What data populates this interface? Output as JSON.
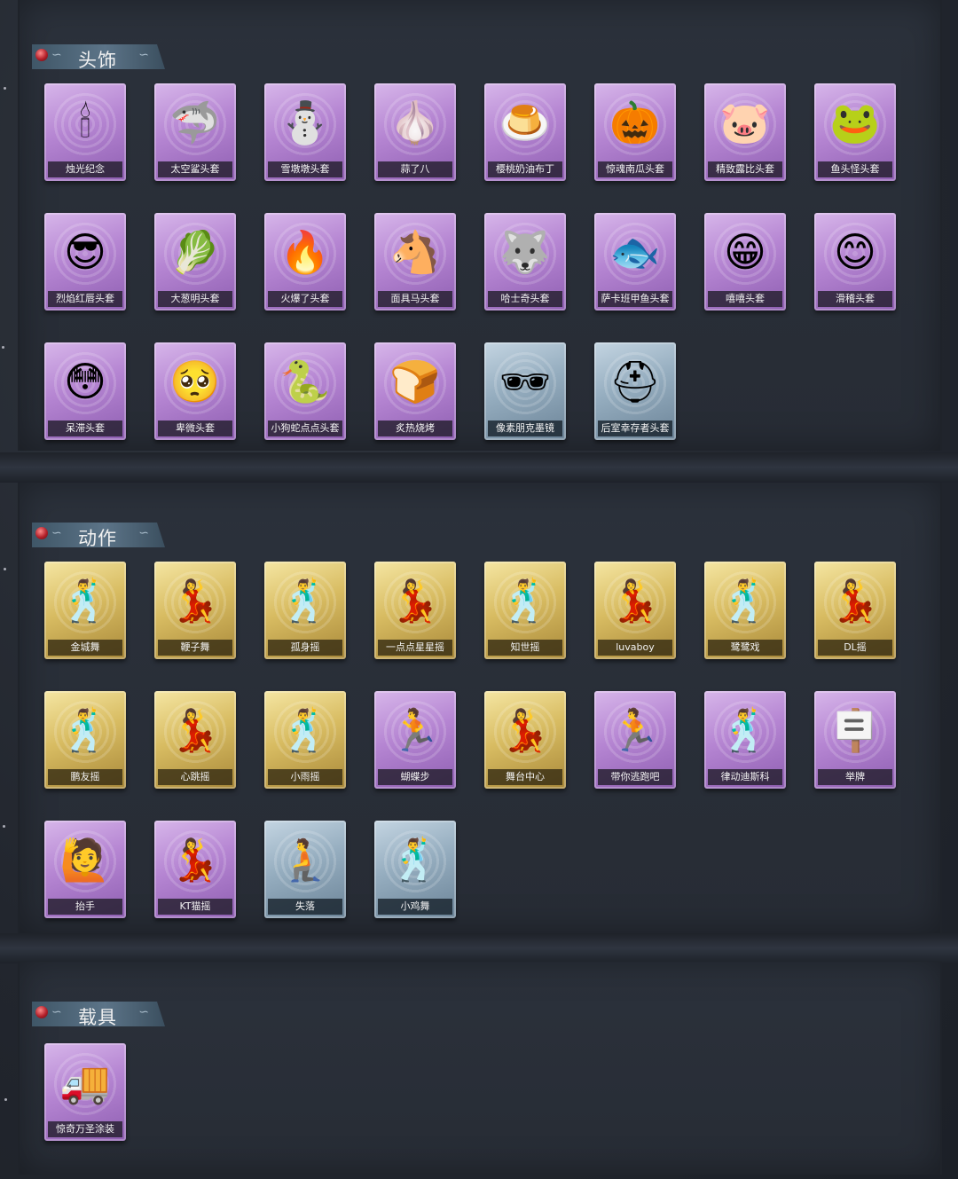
{
  "sections": [
    {
      "title": "头饰",
      "items": [
        {
          "label": "烛光纪念",
          "icon": "candle-head-icon",
          "glyph": "🕯",
          "rarity": "purple"
        },
        {
          "label": "太空鲨头套",
          "icon": "shark-head-icon",
          "glyph": "🦈",
          "rarity": "purple"
        },
        {
          "label": "雪墩墩头套",
          "icon": "snowman-head-icon",
          "glyph": "⛄",
          "rarity": "purple"
        },
        {
          "label": "蒜了八",
          "icon": "garlic-head-icon",
          "glyph": "🧄",
          "rarity": "purple"
        },
        {
          "label": "樱桃奶油布丁",
          "icon": "pudding-head-icon",
          "glyph": "🍮",
          "rarity": "purple"
        },
        {
          "label": "惊魂南瓜头套",
          "icon": "pumpkin-head-icon",
          "glyph": "🎃",
          "rarity": "purple"
        },
        {
          "label": "精致露比头套",
          "icon": "pink-creature-head-icon",
          "glyph": "🐷",
          "rarity": "purple"
        },
        {
          "label": "鱼头怪头套",
          "icon": "fish-head-icon",
          "glyph": "🐸",
          "rarity": "purple"
        },
        {
          "label": "烈焰红唇头套",
          "icon": "pikachu-head-icon",
          "glyph": "😎",
          "rarity": "purple"
        },
        {
          "label": "大葱明头套",
          "icon": "scallion-head-icon",
          "glyph": "🥬",
          "rarity": "purple"
        },
        {
          "label": "火爆了头套",
          "icon": "fireball-head-icon",
          "glyph": "🔥",
          "rarity": "purple"
        },
        {
          "label": "面具马头套",
          "icon": "horse-head-icon",
          "glyph": "🐴",
          "rarity": "purple"
        },
        {
          "label": "哈士奇头套",
          "icon": "husky-head-icon",
          "glyph": "🐺",
          "rarity": "purple"
        },
        {
          "label": "萨卡班甲鱼头套",
          "icon": "sacabambaspis-head-icon",
          "glyph": "🐟",
          "rarity": "purple"
        },
        {
          "label": "嘻嘻头套",
          "icon": "grin-face-head-icon",
          "glyph": "😁",
          "rarity": "purple"
        },
        {
          "label": "滑稽头套",
          "icon": "smirk-face-head-icon",
          "glyph": "😊",
          "rarity": "purple"
        },
        {
          "label": "呆滞头套",
          "icon": "dazed-face-head-icon",
          "glyph": "😳",
          "rarity": "purple"
        },
        {
          "label": "卑微头套",
          "icon": "humble-face-head-icon",
          "glyph": "🥺",
          "rarity": "purple"
        },
        {
          "label": "小狗蛇点点头套",
          "icon": "snake-head-icon",
          "glyph": "🐍",
          "rarity": "purple"
        },
        {
          "label": "炙热烧烤",
          "icon": "toast-head-icon",
          "glyph": "🍞",
          "rarity": "purple"
        },
        {
          "label": "像素朋克墨镜",
          "icon": "pixel-sunglasses-icon",
          "glyph": "🕶",
          "rarity": "blue"
        },
        {
          "label": "后室幸存者头套",
          "icon": "gasmask-helmet-icon",
          "glyph": "⛑",
          "rarity": "blue"
        }
      ]
    },
    {
      "title": "动作",
      "items": [
        {
          "label": "金城舞",
          "icon": "dance-pose-icon",
          "glyph": "🕺",
          "rarity": "gold"
        },
        {
          "label": "鞭子舞",
          "icon": "dance-pose-icon",
          "glyph": "💃",
          "rarity": "gold"
        },
        {
          "label": "孤身摇",
          "icon": "dance-pose-icon",
          "glyph": "🕺",
          "rarity": "gold"
        },
        {
          "label": "一点点星星摇",
          "icon": "dance-pose-icon",
          "glyph": "💃",
          "rarity": "gold"
        },
        {
          "label": "知世摇",
          "icon": "dance-pose-icon",
          "glyph": "🕺",
          "rarity": "gold"
        },
        {
          "label": "luvaboy",
          "icon": "dance-pose-icon",
          "glyph": "💃",
          "rarity": "gold"
        },
        {
          "label": "鹭鹭戏",
          "icon": "dance-pose-icon",
          "glyph": "🕺",
          "rarity": "gold"
        },
        {
          "label": "DL摇",
          "icon": "dance-pose-icon",
          "glyph": "💃",
          "rarity": "gold"
        },
        {
          "label": "鹏友摇",
          "icon": "dance-pose-icon",
          "glyph": "🕺",
          "rarity": "gold"
        },
        {
          "label": "心跳摇",
          "icon": "dance-pose-icon",
          "glyph": "💃",
          "rarity": "gold"
        },
        {
          "label": "小雨摇",
          "icon": "dance-pose-icon",
          "glyph": "🕺",
          "rarity": "gold"
        },
        {
          "label": "蝴蝶步",
          "icon": "dance-pose-icon",
          "glyph": "🏃",
          "rarity": "purple"
        },
        {
          "label": "舞台中心",
          "icon": "dance-pose-icon",
          "glyph": "💃",
          "rarity": "gold"
        },
        {
          "label": "带你逃跑吧",
          "icon": "dance-pose-icon",
          "glyph": "🏃",
          "rarity": "purple"
        },
        {
          "label": "律动迪斯科",
          "icon": "dance-pose-icon",
          "glyph": "🕺",
          "rarity": "purple"
        },
        {
          "label": "举牌",
          "icon": "sign-holding-pose-icon",
          "glyph": "🪧",
          "rarity": "purple"
        },
        {
          "label": "抬手",
          "icon": "hand-raise-pose-icon",
          "glyph": "🙋",
          "rarity": "purple"
        },
        {
          "label": "KT猫摇",
          "icon": "dance-pose-icon",
          "glyph": "💃",
          "rarity": "purple"
        },
        {
          "label": "失落",
          "icon": "crawl-pose-icon",
          "glyph": "🧎",
          "rarity": "blue"
        },
        {
          "label": "小鸡舞",
          "icon": "dance-pose-icon",
          "glyph": "🕺",
          "rarity": "blue"
        }
      ]
    },
    {
      "title": "载具",
      "items": [
        {
          "label": "惊奇万圣涂装",
          "icon": "truck-vehicle-icon",
          "glyph": "🚚",
          "rarity": "purple"
        }
      ]
    }
  ]
}
